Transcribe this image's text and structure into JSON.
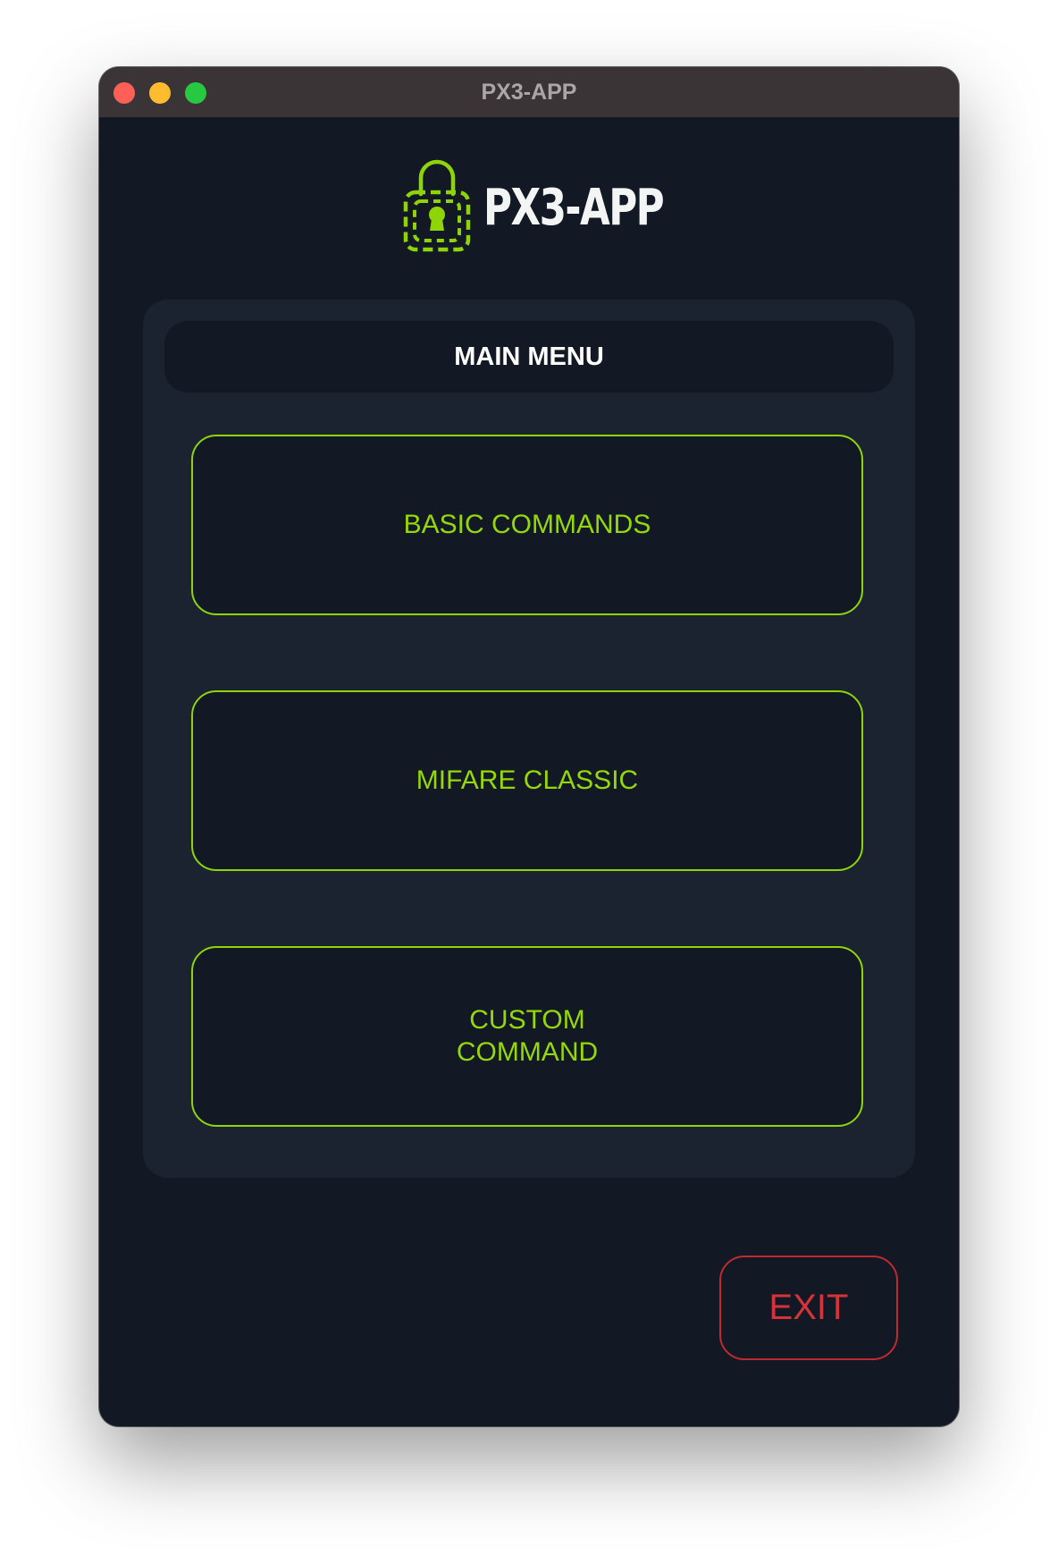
{
  "window": {
    "title": "PX3-APP"
  },
  "logo": {
    "icon": "padlock-keyhole-icon",
    "text": "PX3-APP",
    "accent_color": "#8ed406"
  },
  "main_menu": {
    "heading": "MAIN MENU",
    "buttons": [
      {
        "label": "BASIC COMMANDS"
      },
      {
        "label": "MIFARE CLASSIC"
      },
      {
        "label": "CUSTOM\nCOMMAND"
      }
    ],
    "button_color": "#95d80a"
  },
  "exit": {
    "label": "EXIT",
    "color": "#d43439"
  },
  "colors": {
    "background": "#121925",
    "panel": "#1b2331",
    "titlebar": "#3a3436"
  }
}
